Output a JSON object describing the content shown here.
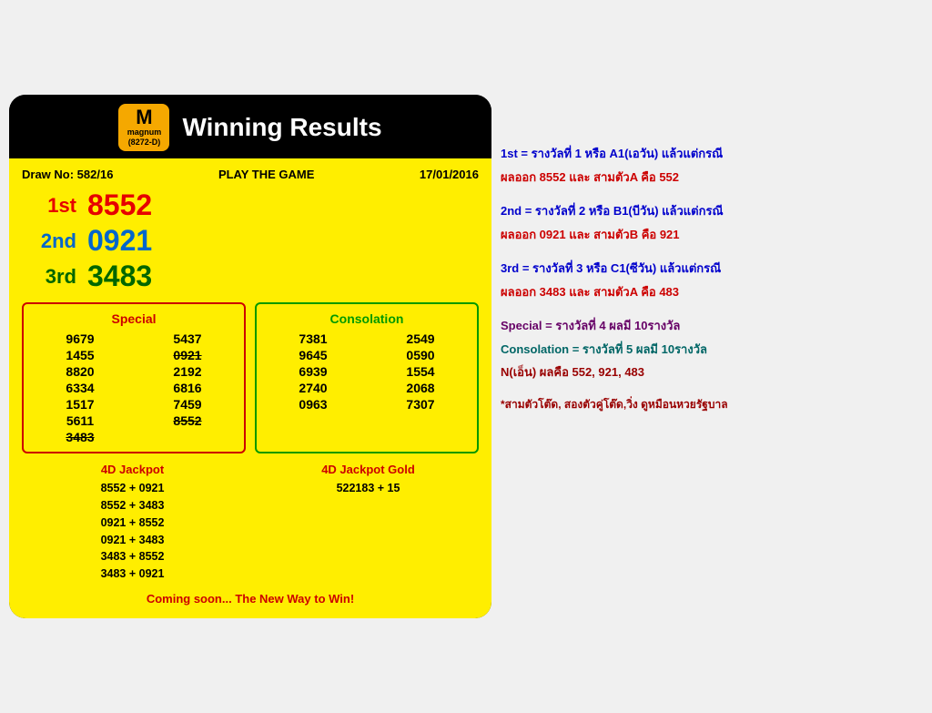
{
  "header": {
    "logo_top": "magnum",
    "logo_sub": "(8272-D)",
    "title": "Winning Results"
  },
  "draw_info": {
    "draw_no_label": "Draw No: 582/16",
    "play_label": "PLAY THE GAME",
    "date": "17/01/2016"
  },
  "main_results": {
    "first": {
      "label": "1st",
      "number": "8552"
    },
    "second": {
      "label": "2nd",
      "number": "0921"
    },
    "third": {
      "label": "3rd",
      "number": "3483"
    }
  },
  "special": {
    "title": "Special",
    "numbers": [
      [
        "9679",
        "5437"
      ],
      [
        "1455",
        "0921"
      ],
      [
        "8820",
        "2192"
      ],
      [
        "6334",
        "6816"
      ],
      [
        "1517",
        "7459"
      ],
      [
        "5611",
        "8552"
      ],
      [
        "3483",
        ""
      ]
    ],
    "strikethrough": [
      "0921",
      "8552",
      "3483"
    ]
  },
  "consolation": {
    "title": "Consolation",
    "numbers": [
      [
        "7381",
        "2549"
      ],
      [
        "9645",
        "0590"
      ],
      [
        "6939",
        "1554"
      ],
      [
        "2740",
        "2068"
      ],
      [
        "0963",
        "7307"
      ]
    ]
  },
  "jackpot": {
    "title": "4D Jackpot",
    "items": [
      "8552 + 0921",
      "8552 + 3483",
      "0921 + 8552",
      "0921 + 3483",
      "3483 + 8552",
      "3483 + 0921"
    ]
  },
  "jackpot_gold": {
    "title": "4D Jackpot Gold",
    "items": [
      "522183 + 15"
    ]
  },
  "footer": "Coming soon... The New Way to Win!",
  "annotations": [
    {
      "text": "1st = รางวัลที่ 1 หรือ A1(เอวัน) แล้วแต่กรณี",
      "class": "ann-blue"
    },
    {
      "text": "ผลออก 8552 และ   สามตัวA คือ 552",
      "class": "ann-red"
    },
    {
      "text": "2nd = รางวัลที่ 2 หรือ B1(บีวัน) แล้วแต่กรณี",
      "class": "ann-blue"
    },
    {
      "text": "ผลออก 0921 และ   สามตัวB คือ 921",
      "class": "ann-red"
    },
    {
      "text": "3rd = รางวัลที่ 3 หรือ C1(ซีวัน) แล้วแต่กรณี",
      "class": "ann-blue"
    },
    {
      "text": "ผลออก 3483 และ   สามตัวA คือ 483",
      "class": "ann-red"
    },
    {
      "text": "Special = รางวัลที่ 4 ผลมี 10รางวัล",
      "class": "ann-purple"
    },
    {
      "text": "Consolation = รางวัลที่ 5 ผลมี 10รางวัล",
      "class": "ann-teal"
    },
    {
      "text": "N(เอ็น) ผลคือ 552, 921, 483",
      "class": "ann-darkred"
    }
  ],
  "bottom_note": "*สามตัวโต๊ด, สองตัวคู่โต๊ด,วิ่ง ดูหมือนหวยรัฐบาล"
}
